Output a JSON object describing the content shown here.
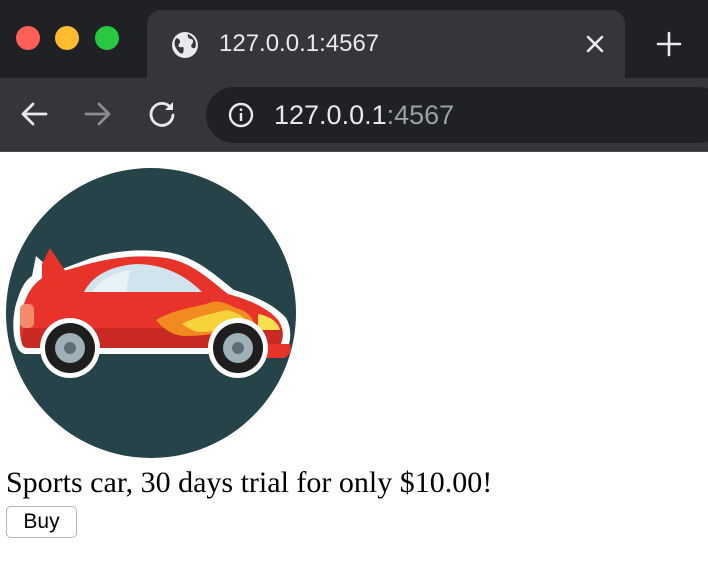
{
  "browser": {
    "tab_title": "127.0.0.1:4567",
    "url_host": "127.0.0.1",
    "url_port": ":4567",
    "icons": {
      "favicon": "globe-icon",
      "tab_close": "close-icon",
      "new_tab": "plus-icon",
      "back": "arrow-left-icon",
      "forward": "arrow-right-icon",
      "reload": "reload-icon",
      "site_info": "info-icon"
    }
  },
  "product": {
    "image_name": "sports-car-image",
    "description": "Sports car, 30 days trial for only $10.00!",
    "buy_label": "Buy"
  },
  "colors": {
    "image_background": "#26434a",
    "car_body": "#e8332a",
    "window": "#cfe4ec"
  }
}
